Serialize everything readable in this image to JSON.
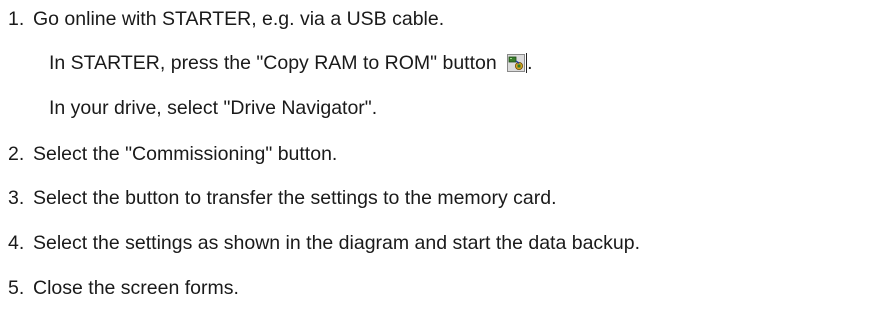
{
  "steps": [
    {
      "number": "1.",
      "text": "Go online with STARTER, e.g. via a USB cable.",
      "sub": [
        {
          "before": "In STARTER, press the \"Copy RAM to ROM\" button",
          "icon": "copy-ram-to-rom-icon",
          "after": "."
        },
        {
          "text": "In your drive, select \"Drive Navigator\"."
        }
      ]
    },
    {
      "number": "2.",
      "text": "Select the \"Commissioning\" button."
    },
    {
      "number": "3.",
      "text": "Select the button to transfer the settings to the memory card."
    },
    {
      "number": "4.",
      "text": "Select the settings as shown in the diagram and start the data backup."
    },
    {
      "number": "5.",
      "text": "Close the screen forms."
    }
  ]
}
